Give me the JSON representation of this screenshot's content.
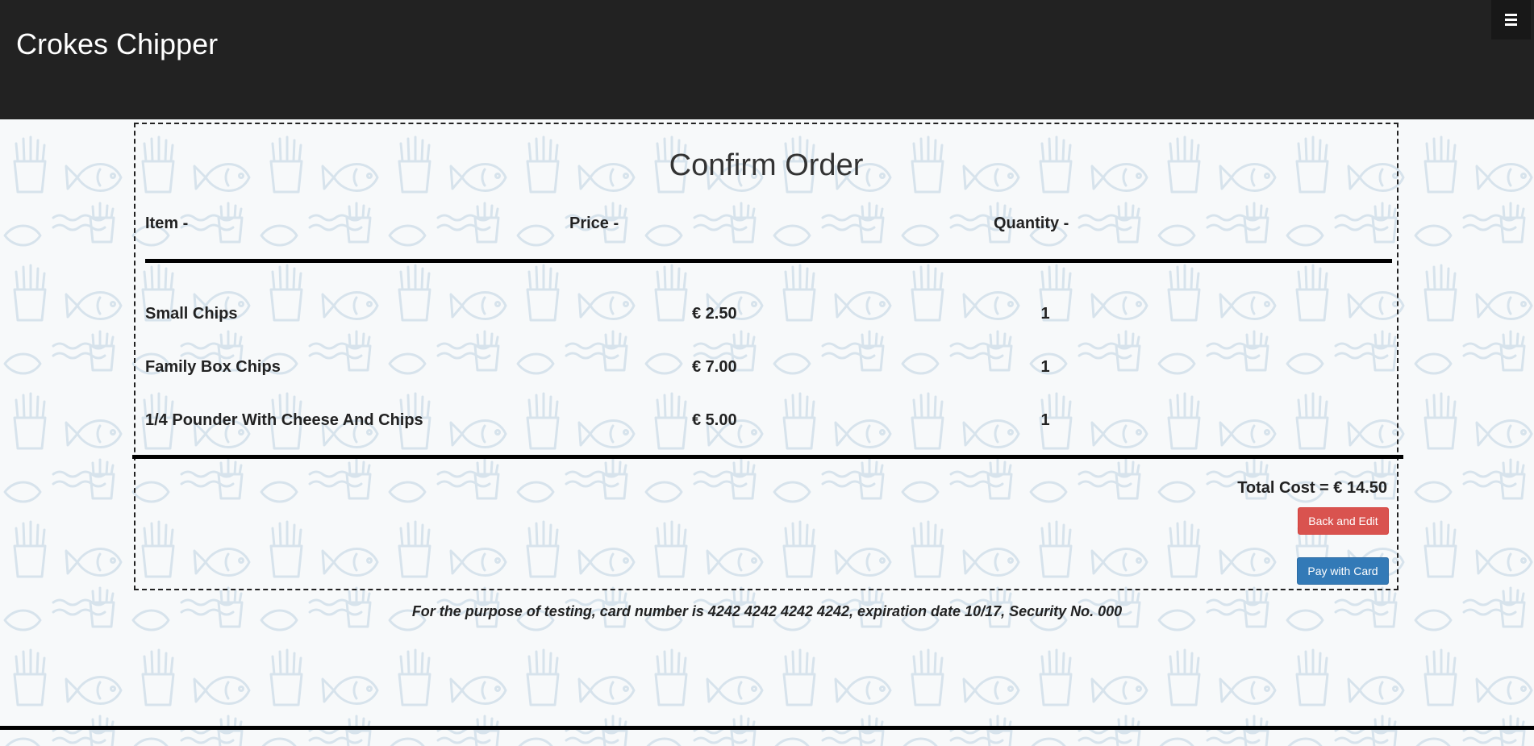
{
  "navbar": {
    "brand": "Crokes Chipper",
    "menu_icon": "hamburger-menu-icon"
  },
  "order": {
    "title": "Confirm Order",
    "headers": {
      "item": "Item -",
      "price": "Price -",
      "quantity": "Quantity -"
    },
    "rows": [
      {
        "item": "Small Chips",
        "price": "€ 2.50",
        "quantity": "1"
      },
      {
        "item": "Family Box Chips",
        "price": "€ 7.00",
        "quantity": "1"
      },
      {
        "item": "1/4 Pounder With Cheese And Chips",
        "price": "€ 5.00",
        "quantity": "1"
      }
    ],
    "total": "Total Cost = € 14.50",
    "back_button": "Back and Edit",
    "pay_button": "Pay with Card"
  },
  "test_note": "For the purpose of testing, card number is 4242 4242 4242 4242, expiration date 10/17, Security No. 000",
  "colors": {
    "navbar_bg": "#222222",
    "danger": "#d9534f",
    "primary": "#337ab7",
    "pattern_stroke": "#d7e3ec"
  },
  "background_icons": [
    "fries-icon",
    "fish-icon",
    "wave-icon"
  ]
}
